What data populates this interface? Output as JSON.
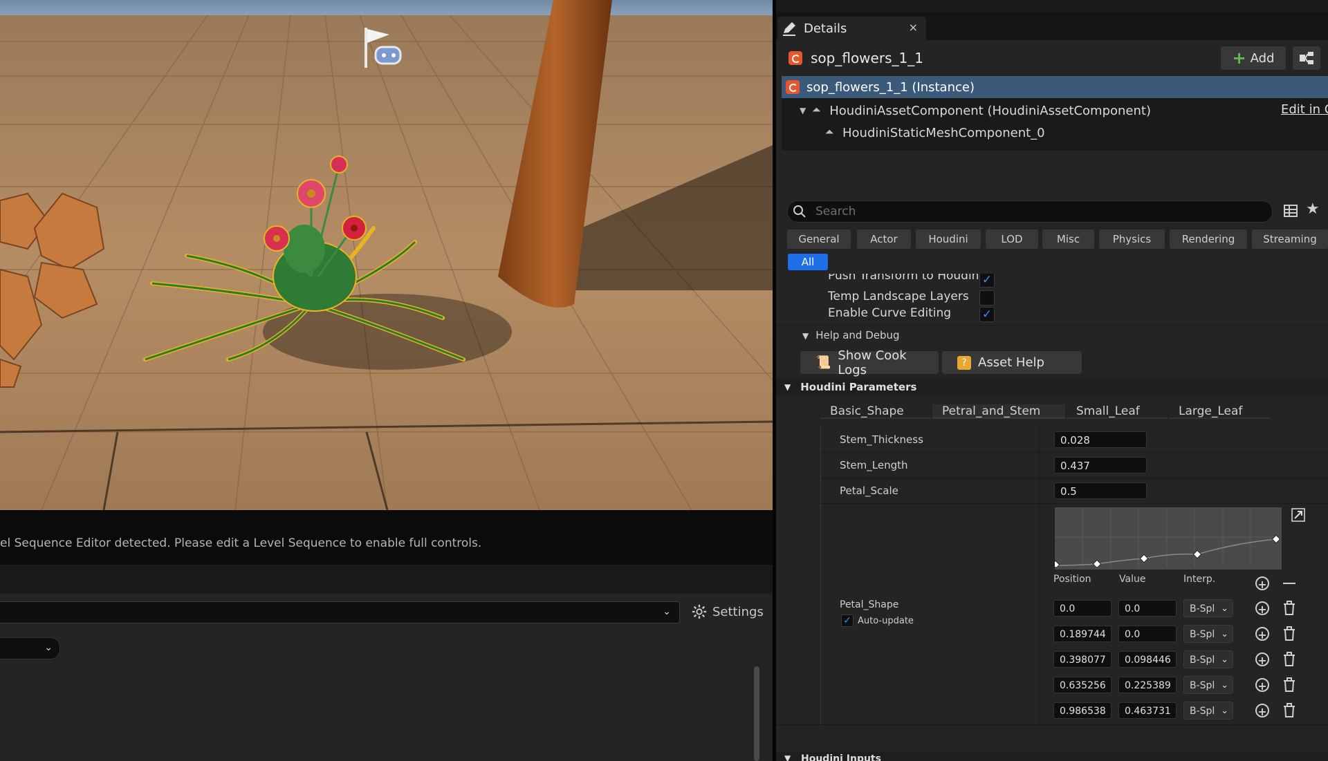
{
  "viewport": {
    "status_message": "el Sequence Editor detected. Please edit a Level Sequence to enable full controls."
  },
  "sequencer": {
    "settings_label": "Settings"
  },
  "details": {
    "tab_title": "Details",
    "close_glyph": "×",
    "actor_name": "sop_flowers_1_1",
    "add_label": "Add",
    "tree": [
      "sop_flowers_1_1 (Instance)",
      "HoudiniAssetComponent (HoudiniAssetComponent)",
      "HoudiniStaticMeshComponent_0"
    ],
    "edit_link": "Edit in C",
    "search_placeholder": "Search",
    "categories": [
      "General",
      "Actor",
      "Houdini",
      "LOD",
      "Misc",
      "Physics",
      "Rendering",
      "Streaming"
    ],
    "category_selected": "All",
    "props": [
      {
        "label": "Push Transform to Houdini",
        "checked": true
      },
      {
        "label": "Temp Landscape Layers",
        "checked": false
      },
      {
        "label": "Enable Curve Editing",
        "checked": true
      }
    ],
    "help_section": "Help and Debug",
    "show_cook_logs": "Show Cook Logs",
    "asset_help": "Asset Help",
    "houdini_params_header": "Houdini Parameters",
    "param_tabs": [
      "Basic_Shape",
      "Petral_and_Stem",
      "Small_Leaf",
      "Large_Leaf"
    ],
    "active_param_tab": "Petral_and_Stem",
    "params": [
      {
        "name": "Stem_Thickness",
        "value": "0.028"
      },
      {
        "name": "Stem_Length",
        "value": "0.437"
      },
      {
        "name": "Petal_Scale",
        "value": "0.5"
      }
    ],
    "ramp": {
      "name": "Petal_Shape",
      "auto_update_label": "Auto-update",
      "auto_update": true,
      "col_position": "Position",
      "col_value": "Value",
      "col_interp": "Interp.",
      "points": [
        {
          "position": "0.0",
          "value": "0.0",
          "interp": "B-Spl"
        },
        {
          "position": "0.189744",
          "value": "0.0",
          "interp": "B-Spl"
        },
        {
          "position": "0.398077",
          "value": "0.098446",
          "interp": "B-Spl"
        },
        {
          "position": "0.635256",
          "value": "0.225389",
          "interp": "B-Spl"
        },
        {
          "position": "0.986538",
          "value": "0.463731",
          "interp": "B-Spl"
        }
      ]
    },
    "inputs_header": "Houdini Inputs"
  },
  "colors": {
    "accent": "#1c6fe8",
    "selection": "#3b5a7a",
    "houdini_orange": "#e4572e"
  }
}
